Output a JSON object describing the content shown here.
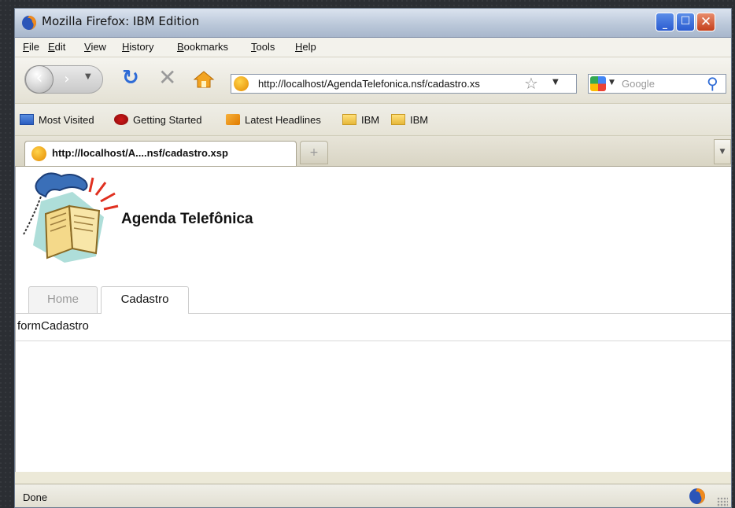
{
  "window": {
    "title": "Mozilla Firefox: IBM Edition"
  },
  "menu": [
    "File",
    "Edit",
    "View",
    "History",
    "Bookmarks",
    "Tools",
    "Help"
  ],
  "nav": {
    "url": "http://localhost/AgendaTelefonica.nsf/cadastro.xs",
    "search_placeholder": "Google"
  },
  "bookmarks": [
    "Most Visited",
    "Getting Started",
    "Latest Headlines",
    "IBM",
    "IBM"
  ],
  "tab": {
    "label": "http://localhost/A....nsf/cadastro.xsp"
  },
  "page": {
    "title": "Agenda Telefônica",
    "tabs": [
      "Home",
      "Cadastro"
    ],
    "active_tab": "Cadastro",
    "form_label": "formCadastro"
  },
  "status": {
    "text": "Done"
  }
}
